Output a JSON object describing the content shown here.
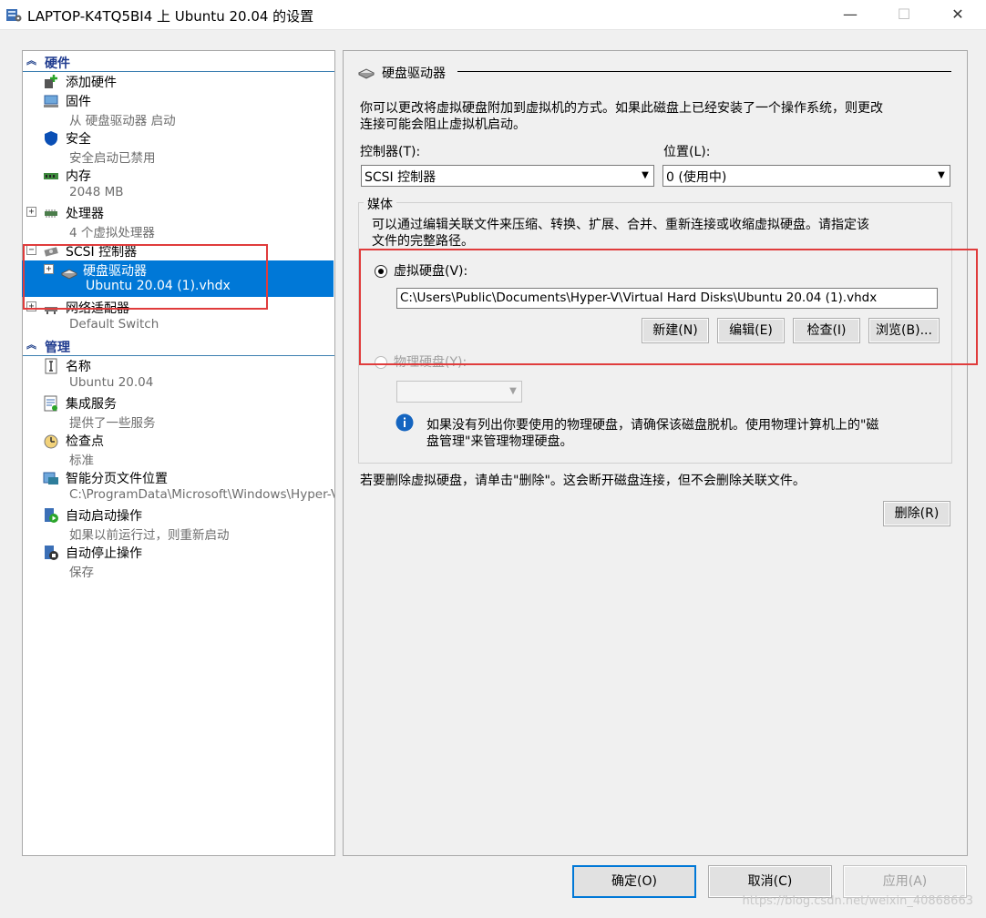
{
  "window": {
    "title": "LAPTOP-K4TQ5BI4 上 Ubuntu 20.04 的设置",
    "minimize": "—",
    "maximize": "☐",
    "close": "✕"
  },
  "tree": {
    "hardware_label": "硬件",
    "management_label": "管理",
    "hardware_items": [
      {
        "name": "添加硬件",
        "sub": ""
      },
      {
        "name": "固件",
        "sub": "从 硬盘驱动器 启动"
      },
      {
        "name": "安全",
        "sub": "安全启动已禁用"
      },
      {
        "name": "内存",
        "sub": "2048 MB"
      },
      {
        "name": "处理器",
        "sub": "4 个虚拟处理器"
      },
      {
        "name": "SCSI 控制器",
        "sub": ""
      },
      {
        "name": "硬盘驱动器",
        "sub": "Ubuntu 20.04 (1).vhdx"
      },
      {
        "name": "网络适配器",
        "sub": "Default Switch"
      }
    ],
    "management_items": [
      {
        "name": "名称",
        "sub": "Ubuntu 20.04"
      },
      {
        "name": "集成服务",
        "sub": "提供了一些服务"
      },
      {
        "name": "检查点",
        "sub": "标准"
      },
      {
        "name": "智能分页文件位置",
        "sub": "C:\\ProgramData\\Microsoft\\Windows\\Hyper-V"
      },
      {
        "name": "自动启动操作",
        "sub": "如果以前运行过，则重新启动"
      },
      {
        "name": "自动停止操作",
        "sub": "保存"
      }
    ]
  },
  "panel": {
    "heading": "硬盘驱动器",
    "description_line1": "你可以更改将虚拟硬盘附加到虚拟机的方式。如果此磁盘上已经安装了一个操作系统，则更改",
    "description_line2": "连接可能会阻止虚拟机启动。",
    "controller_label": "控制器(T):",
    "controller_value": "SCSI 控制器",
    "location_label": "位置(L):",
    "location_value": "0 (使用中)",
    "media_label": "媒体",
    "media_desc_line1": "可以通过编辑关联文件来压缩、转换、扩展、合并、重新连接或收缩虚拟硬盘。请指定该",
    "media_desc_line2": "文件的完整路径。",
    "vhd_label": "虚拟硬盘(V):",
    "vhd_path": "C:\\Users\\Public\\Documents\\Hyper-V\\Virtual Hard Disks\\Ubuntu 20.04 (1).vhdx",
    "btn_new": "新建(N)",
    "btn_edit": "编辑(E)",
    "btn_inspect": "检查(I)",
    "btn_browse": "浏览(B)...",
    "physical_label": "物理硬盘(Y):",
    "info_line1": "如果没有列出你要使用的物理硬盘，请确保该磁盘脱机。使用物理计算机上的\"磁",
    "info_line2": "盘管理\"来管理物理硬盘。",
    "remove_note": "若要删除虚拟硬盘，请单击\"删除\"。这会断开磁盘连接，但不会删除关联文件。",
    "btn_remove": "删除(R)"
  },
  "footer": {
    "ok": "确定(O)",
    "cancel": "取消(C)",
    "apply": "应用(A)",
    "watermark": "https://blog.csdn.net/weixin_40868663"
  },
  "colors": {
    "selection": "#0078d7",
    "highlight_box": "#e03c3c",
    "category_text": "#1f3b8f"
  }
}
